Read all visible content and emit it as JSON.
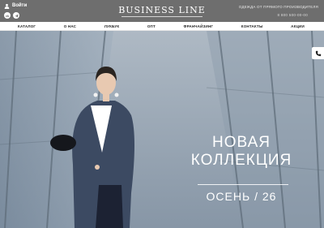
{
  "header": {
    "login_label": "Войти",
    "socials": [
      {
        "label": "vk",
        "icon": "vk-icon"
      },
      {
        "label": "tg",
        "icon": "telegram-icon"
      }
    ],
    "logo": "BUSINESS LINE",
    "tagline": "ОДЕЖДА ОТ ПРЯМОГО ПРОИЗВОДИТЕЛЯ",
    "phone": "8 800 500-00-00"
  },
  "nav": {
    "items": [
      "КАТАЛОГ",
      "О НАС",
      "ЛУКБУК",
      "ОПТ",
      "ФРАНЧАЙЗИНГ",
      "КОНТАКТЫ",
      "АКЦИИ"
    ]
  },
  "hero": {
    "headline_line1": "НОВАЯ",
    "headline_line2": "КОЛЛЕКЦИЯ",
    "season": "ОСЕНЬ / 26"
  },
  "colors": {
    "topbar": "#6e6e6e",
    "nav_background": "#ffffff",
    "hero_sky": "#9aa7b3"
  },
  "icons": {
    "call": "phone-icon",
    "login": "user-icon"
  }
}
